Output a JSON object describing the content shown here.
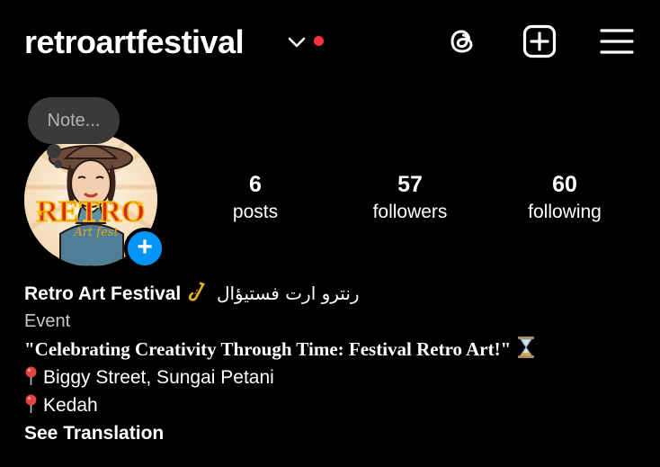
{
  "header": {
    "username": "retroartfestival",
    "icons": [
      "threads-icon",
      "create-post-icon",
      "menu-icon"
    ],
    "notification_dot_color": "#ff3040"
  },
  "note": {
    "placeholder": "Note..."
  },
  "avatar": {
    "logo_text_main": "RETRO",
    "logo_text_sub": "Art fest"
  },
  "stats": [
    {
      "value": "6",
      "label": "posts"
    },
    {
      "value": "57",
      "label": "followers"
    },
    {
      "value": "60",
      "label": "following"
    }
  ],
  "bio": {
    "name": "Retro Art Festival",
    "name_arabic": "رنترو ارت فستيؤال",
    "category": "Event",
    "quote": "\"Celebrating Creativity Through Time: Festival Retro Art!\"",
    "location_1": "Biggy Street, Sungai Petani",
    "location_2": "Kedah",
    "see_translation": "See Translation"
  },
  "colors": {
    "background": "#000000",
    "accent_blue": "#0095f6",
    "note_bubble": "#3a3a3a"
  }
}
